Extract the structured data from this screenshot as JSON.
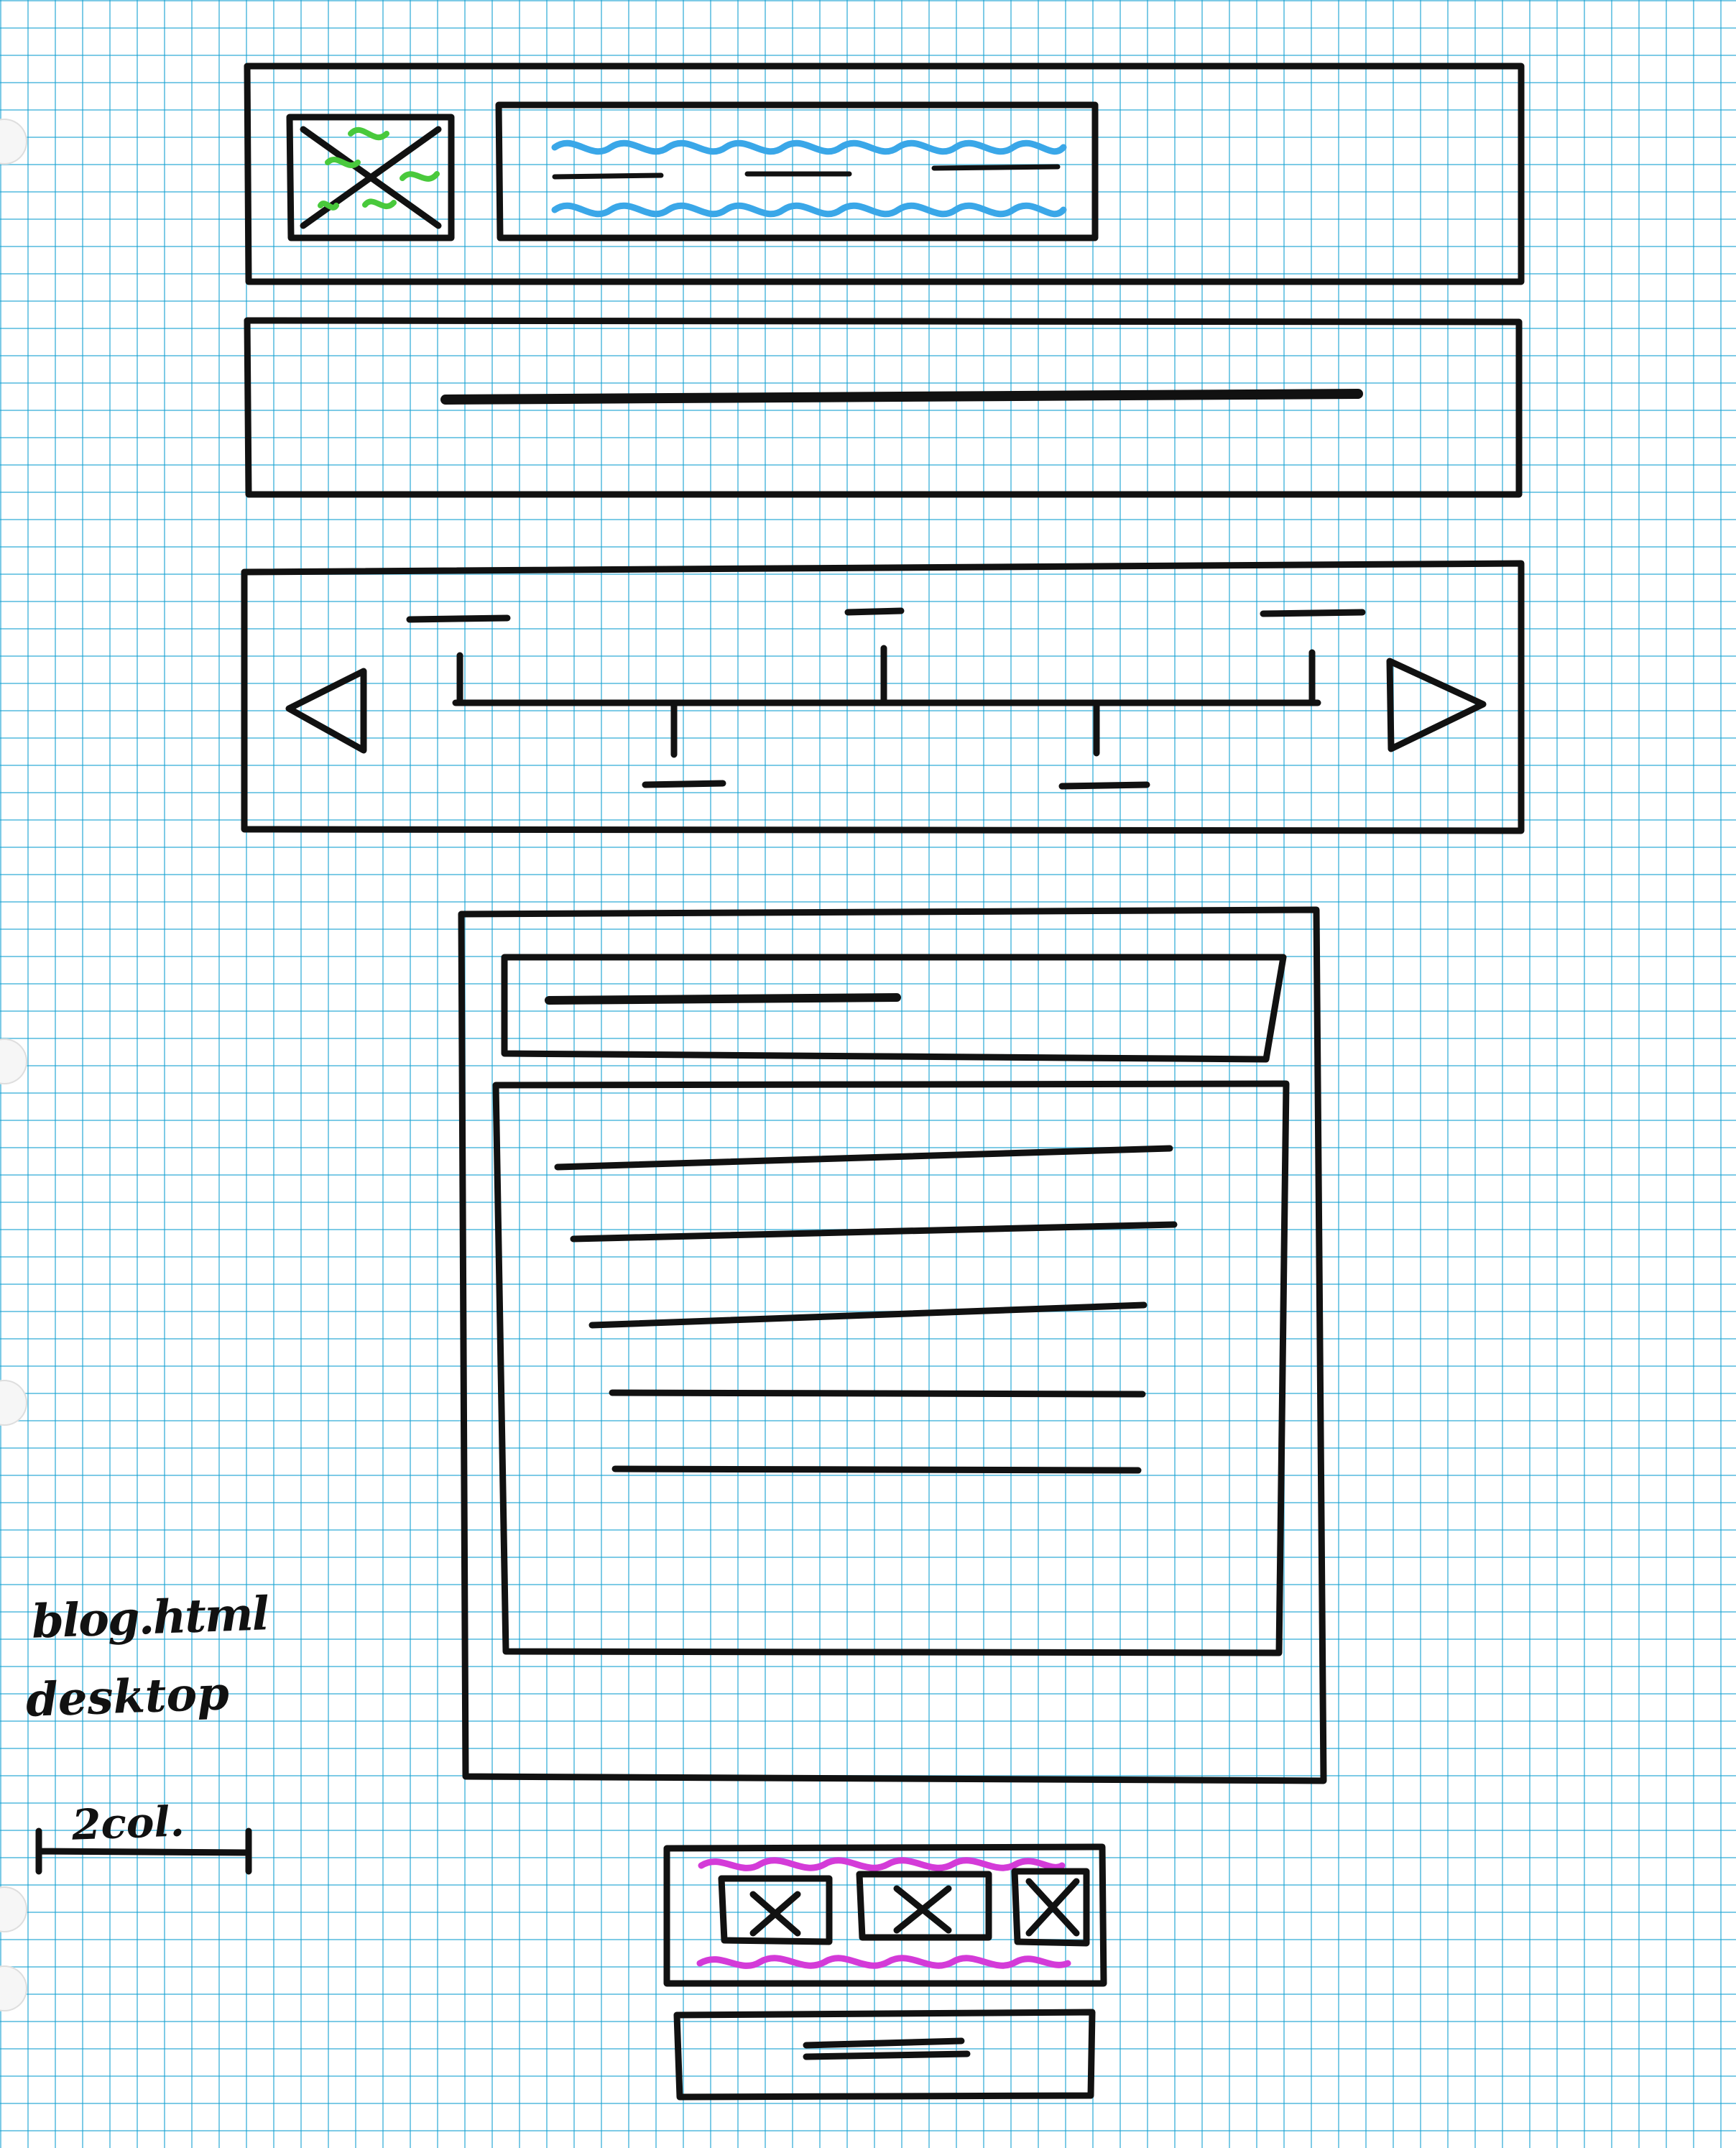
{
  "notes": {
    "page_name": "blog.html",
    "device": "desktop",
    "scale_label": "2col."
  },
  "colors": {
    "ink": "#111111",
    "grid": "#14a0d2",
    "image_placeholder_scribble": "#49c93c",
    "header_scribble": "#3aa7e8",
    "footer_scribble": "#d43bd8"
  }
}
